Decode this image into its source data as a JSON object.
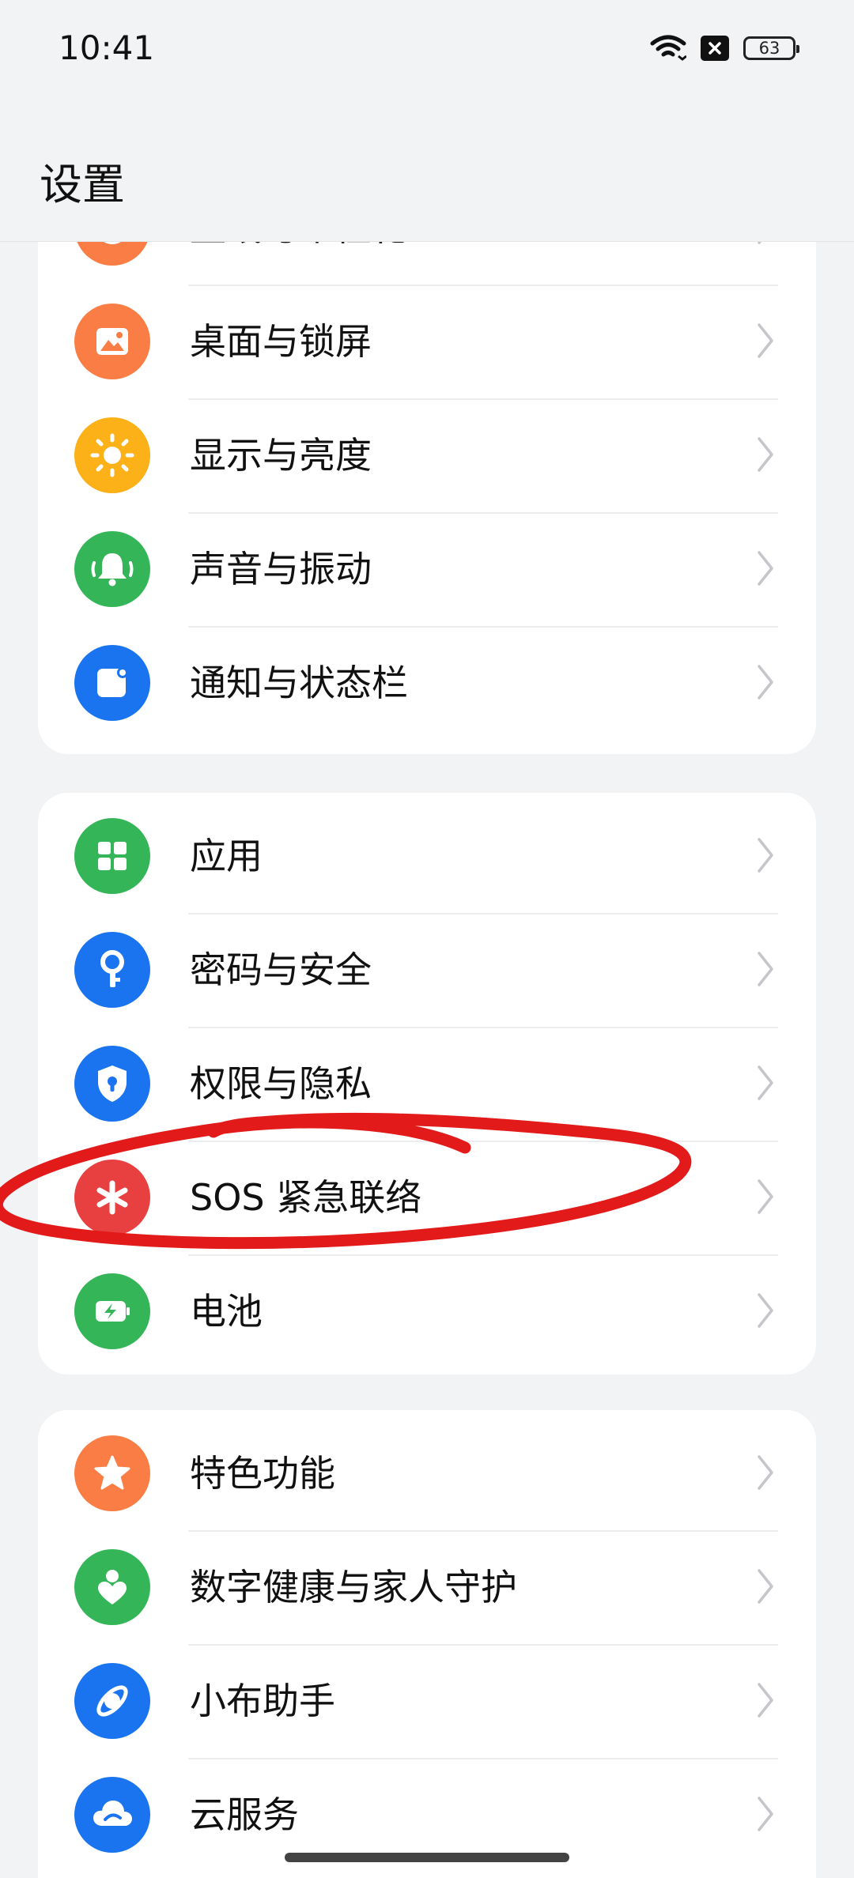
{
  "status_bar": {
    "time": "10:41",
    "battery": "63"
  },
  "header": {
    "title": "设置"
  },
  "groups": [
    {
      "items": [
        {
          "label": "壁纸与个性化",
          "icon": "palette-icon",
          "color": "#f97d45"
        },
        {
          "label": "桌面与锁屏",
          "icon": "picture-icon",
          "color": "#f97d45"
        },
        {
          "label": "显示与亮度",
          "icon": "sun-icon",
          "color": "#fbb117"
        },
        {
          "label": "声音与振动",
          "icon": "bell-icon",
          "color": "#34b557"
        },
        {
          "label": "通知与状态栏",
          "icon": "notification-icon",
          "color": "#1a74f0"
        }
      ]
    },
    {
      "items": [
        {
          "label": "应用",
          "icon": "apps-grid-icon",
          "color": "#34b557"
        },
        {
          "label": "密码与安全",
          "icon": "key-icon",
          "color": "#1a74f0"
        },
        {
          "label": "权限与隐私",
          "icon": "shield-lock-icon",
          "color": "#1a74f0"
        },
        {
          "label": "SOS 紧急联络",
          "icon": "asterisk-icon",
          "color": "#e84040"
        },
        {
          "label": "电池",
          "icon": "battery-charge-icon",
          "color": "#34b557"
        }
      ]
    },
    {
      "items": [
        {
          "label": "特色功能",
          "icon": "star-icon",
          "color": "#f97d45"
        },
        {
          "label": "数字健康与家人守护",
          "icon": "family-heart-icon",
          "color": "#34b557"
        },
        {
          "label": "小布助手",
          "icon": "assistant-icon",
          "color": "#1a74f0"
        },
        {
          "label": "云服务",
          "icon": "cloud-icon",
          "color": "#1a74f0"
        }
      ]
    }
  ],
  "annotation": {
    "stroke_color": "#e21a1a"
  }
}
